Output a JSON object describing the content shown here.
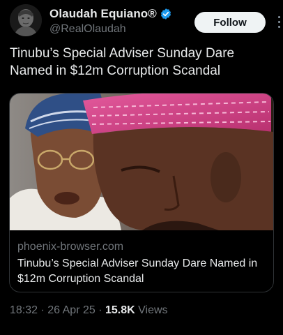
{
  "author": {
    "display_name": "Olaudah Equiano®",
    "handle": "@RealOlaudah",
    "verified": true,
    "avatar_icon": "portrait-avatar-icon"
  },
  "actions": {
    "follow_label": "Follow",
    "more_icon": "more-vertical-icon"
  },
  "tweet": {
    "text": "Tinubu’s Special Adviser Sunday Dare Named in $12m Corruption Scandal"
  },
  "link_card": {
    "domain": "phoenix-browser.com",
    "title": "Tinubu’s Special Adviser Sunday Dare Named in $12m Corruption Scandal",
    "image_icon": "news-photo-two-men"
  },
  "meta": {
    "time": "18:32",
    "separator": " · ",
    "date": "26 Apr 25",
    "views_count": "15.8K",
    "views_label": "Views"
  },
  "colors": {
    "background": "#000000",
    "text_primary": "#e7e9ea",
    "text_secondary": "#71767b",
    "verified_blue": "#1d9bf0",
    "follow_bg": "#eff3f4",
    "border": "#2f3336"
  }
}
